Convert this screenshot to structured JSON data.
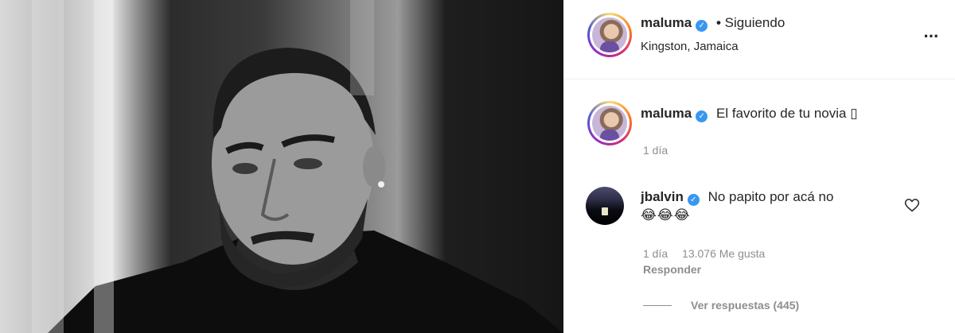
{
  "post_header": {
    "username": "maluma",
    "separator": "•",
    "follow_status": "Siguiendo",
    "location": "Kingston, Jamaica",
    "more_icon": "more-options-icon"
  },
  "caption": {
    "username": "maluma",
    "text": "El favorito de tu novia ▯",
    "time": "1 día"
  },
  "comment": {
    "username": "jbalvin",
    "text": "No papito por acá no",
    "emoji": "😂😂😂",
    "time": "1 día",
    "likes": "13.076 Me gusta",
    "reply_label": "Responder",
    "view_replies": "Ver respuestas (445)"
  },
  "colors": {
    "verified": "#3897f0",
    "muted": "#8e8e8e",
    "text": "#262626"
  }
}
